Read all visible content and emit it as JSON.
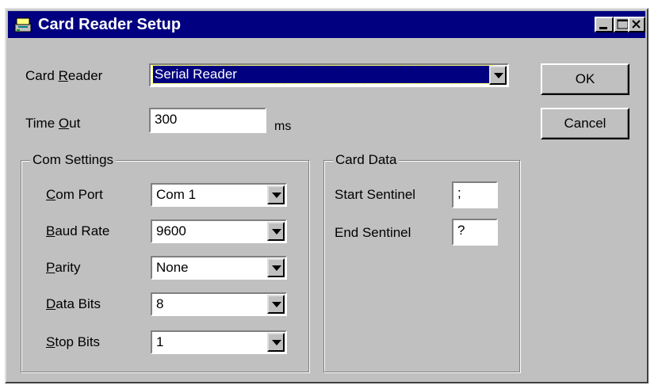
{
  "window": {
    "title": "Card Reader Setup"
  },
  "form": {
    "card_reader": {
      "label_pre": "Card ",
      "label_key": "R",
      "label_post": "eader",
      "value": "Serial Reader"
    },
    "time_out": {
      "label_pre": "Time ",
      "label_key": "O",
      "label_post": "ut",
      "value": "300",
      "unit": "ms"
    }
  },
  "com_settings": {
    "legend": "Com Settings",
    "com_port": {
      "label_key": "C",
      "label_post": "om Port",
      "value": "Com 1"
    },
    "baud_rate": {
      "label_key": "B",
      "label_post": "aud Rate",
      "value": "9600"
    },
    "parity": {
      "label_key": "P",
      "label_post": "arity",
      "value": "None"
    },
    "data_bits": {
      "label_key": "D",
      "label_post": "ata Bits",
      "value": "8"
    },
    "stop_bits": {
      "label_key": "S",
      "label_post": "top Bits",
      "value": "1"
    }
  },
  "card_data": {
    "legend": "Card Data",
    "start_sentinel": {
      "label": "Start Sentinel",
      "value": ";"
    },
    "end_sentinel": {
      "label": "End Sentinel",
      "value": "?"
    }
  },
  "buttons": {
    "ok": "OK",
    "cancel": "Cancel"
  },
  "icons": {
    "app": "card-reader-icon",
    "minimize": "minimize-icon",
    "maximize": "maximize-icon",
    "close": "close-icon"
  },
  "colors": {
    "titlebar": "#000080",
    "face": "#c0c0c0",
    "selection": "#000080"
  }
}
